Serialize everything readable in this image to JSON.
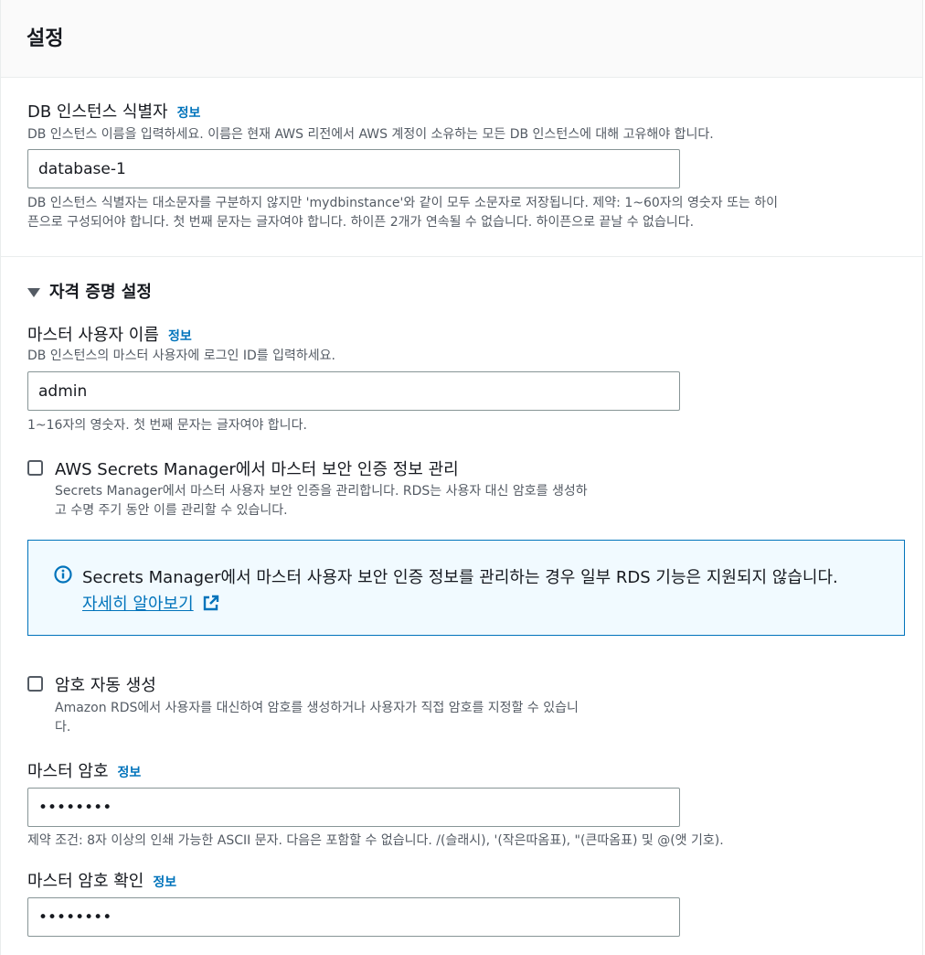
{
  "header": {
    "title": "설정"
  },
  "db_identifier": {
    "label": "DB 인스턴스 식별자",
    "info": "정보",
    "description": "DB 인스턴스 이름을 입력하세요. 이름은 현재 AWS 리전에서 AWS 계정이 소유하는 모든 DB 인스턴스에 대해 고유해야 합니다.",
    "value": "database-1",
    "constraint_line1": "DB 인스턴스 식별자는 대소문자를 구분하지 않지만 'mydbinstance'와 같이 모두 소문자로 저장됩니다. 제약: 1~60자의 영숫자 또는 하이",
    "constraint_line2": "픈으로 구성되어야 합니다. 첫 번째 문자는 글자여야 합니다. 하이픈 2개가 연속될 수 없습니다. 하이픈으로 끝날 수 없습니다."
  },
  "credentials": {
    "section_title": "자격 증명 설정",
    "expanded": true,
    "master_username": {
      "label": "마스터 사용자 이름",
      "info": "정보",
      "description": "DB 인스턴스의 마스터 사용자에 로그인 ID를 입력하세요.",
      "value": "admin",
      "constraint": "1~16자의 영숫자. 첫 번째 문자는 글자여야 합니다."
    },
    "secrets_manager": {
      "label": "AWS Secrets Manager에서 마스터 보안 인증 정보 관리",
      "checked": false,
      "description_line1": "Secrets Manager에서 마스터 사용자 보안 인증을 관리합니다. RDS는 사용자 대신 암호를 생성하",
      "description_line2": "고 수명 주기 동안 이를 관리할 수 있습니다."
    },
    "info_alert": {
      "icon": "info-circle-icon",
      "text": "Secrets Manager에서 마스터 사용자 보안 인증 정보를 관리하는 경우 일부 RDS 기능은 지원되지 않습니다.",
      "link": "자세히 알아보기"
    },
    "auto_generate": {
      "label": "암호 자동 생성",
      "checked": false,
      "description_line1": "Amazon RDS에서 사용자를 대신하여 암호를 생성하거나 사용자가 직접 암호를 지정할 수 있습니",
      "description_line2": "다."
    },
    "master_password": {
      "label": "마스터 암호",
      "info": "정보",
      "value": "••••••••",
      "constraint": "제약 조건: 8자 이상의 인쇄 가능한 ASCII 문자. 다음은 포함할 수 없습니다. /(슬래시), '(작은따옴표), \"(큰따옴표) 및 @(앳 기호)."
    },
    "confirm_password": {
      "label": "마스터 암호 확인",
      "info": "정보",
      "value": "••••••••"
    }
  },
  "colors": {
    "link": "#0073bb",
    "info_bg": "#f1faff",
    "text": "#16191f",
    "secondary_text": "#545b64"
  }
}
